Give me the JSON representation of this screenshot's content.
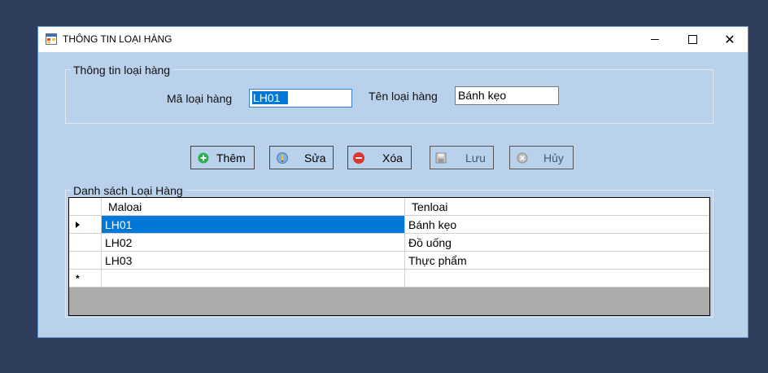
{
  "window": {
    "title": "THÔNG TIN LOẠI HÀNG"
  },
  "info_group": {
    "title": "Thông tin loại hàng",
    "ma_label": "Mã loại hàng",
    "ma_value": "LH01",
    "ten_label": "Tên loại hàng",
    "ten_value": "Bánh kẹo"
  },
  "toolbar": {
    "them": "Thêm",
    "sua": "Sửa",
    "xoa": "Xóa",
    "luu": "Lưu",
    "huy": "Hủy"
  },
  "list_group": {
    "title": "Danh sách Loại Hàng",
    "columns": [
      "Maloai",
      "Tenloai"
    ],
    "rows": [
      {
        "maloai": "LH01",
        "tenloai": "Bánh kẹo"
      },
      {
        "maloai": "LH02",
        "tenloai": "Đồ uống"
      },
      {
        "maloai": "LH03",
        "tenloai": "Thực phẩm"
      }
    ],
    "new_row_marker": "*"
  },
  "colors": {
    "form_bg": "#b9d1ea",
    "selection": "#0078d7",
    "add_icon": "#2bb24c",
    "delete_icon": "#e0352b"
  },
  "icons": [
    "app-icon",
    "minimize-icon",
    "maximize-icon",
    "close-icon",
    "add-icon",
    "edit-icon",
    "delete-icon",
    "save-icon",
    "cancel-icon"
  ]
}
